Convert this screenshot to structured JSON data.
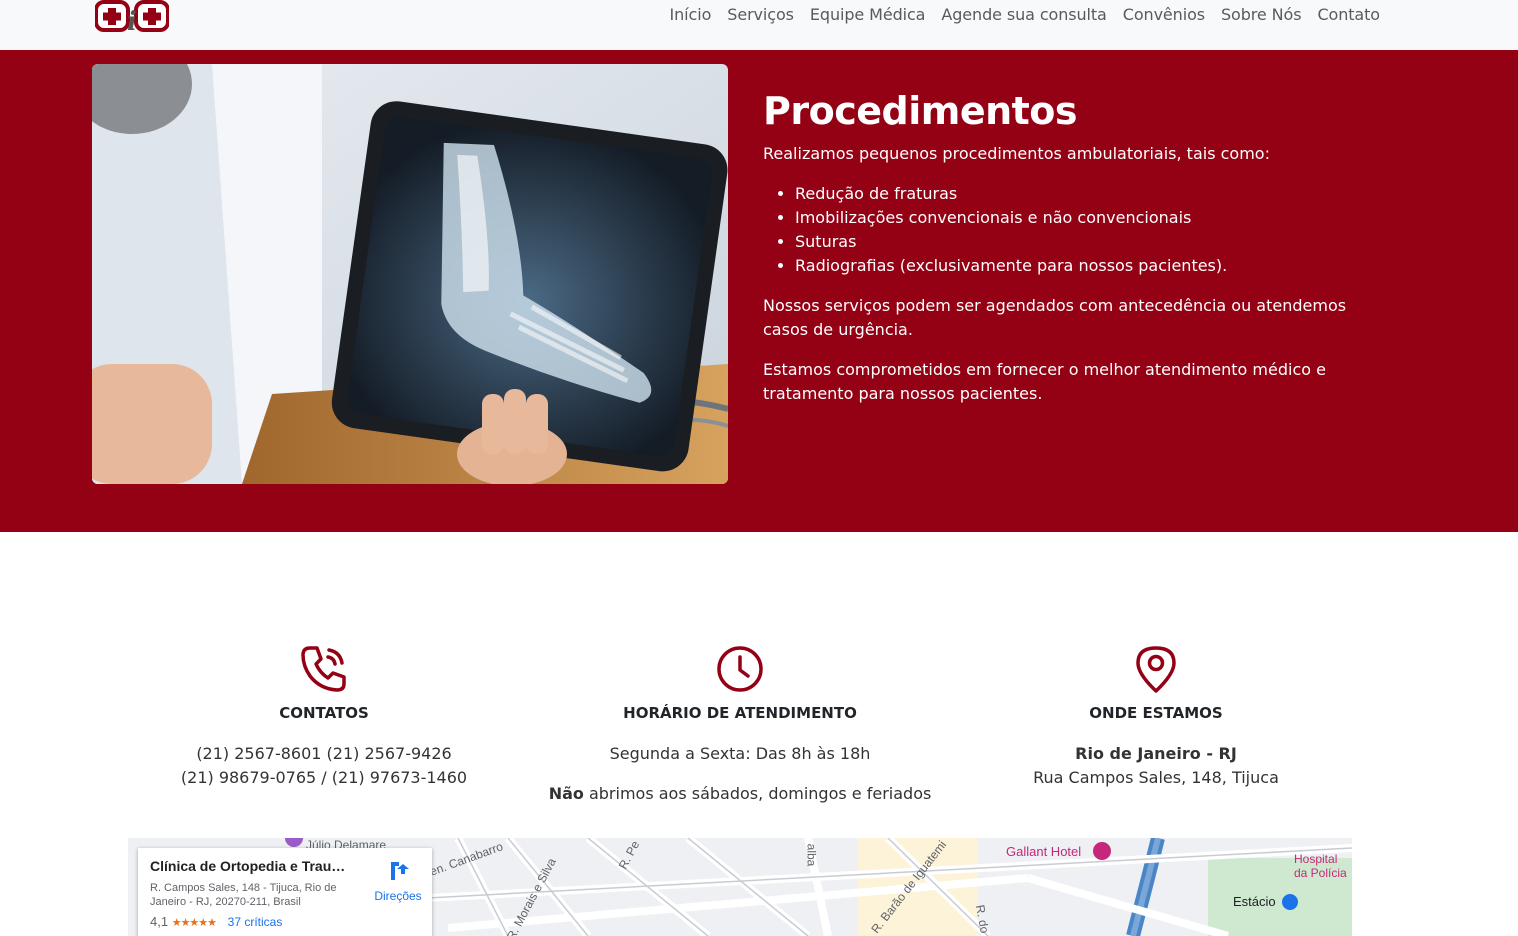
{
  "nav": {
    "logo_alt": "logo",
    "links": [
      "Início",
      "Serviços",
      "Equipe Médica",
      "Agende sua consulta",
      "Convênios",
      "Sobre Nós",
      "Contato"
    ]
  },
  "hero": {
    "title": "Procedimentos",
    "intro": "Realizamos pequenos procedimentos ambulatoriais, tais como:",
    "items": [
      "Redução de fraturas",
      "Imobilizações convencionais e não convencionais",
      "Suturas",
      "Radiografias (exclusivamente para nossos pacientes)."
    ],
    "p1": "Nossos serviços podem ser agendados com antecedência ou atendemos casos de urgência.",
    "p2": "Estamos comprometidos em fornecer o melhor atendimento médico e tratamento para nossos pacientes."
  },
  "info": {
    "contacts": {
      "title": "CONTATOS",
      "line1": "(21) 2567-8601 (21) 2567-9426",
      "line2": "(21) 98679-0765 / (21) 97673-1460"
    },
    "hours": {
      "title": "HORÁRIO DE ATENDIMENTO",
      "line1": "Segunda a Sexta: Das 8h às 18h",
      "bold": "Não",
      "line2_rest": " abrimos aos sábados, domingos e feriados"
    },
    "location": {
      "title": "ONDE ESTAMOS",
      "city": "Rio de Janeiro - RJ",
      "address": "Rua Campos Sales, 148, Tijuca"
    }
  },
  "map": {
    "card_title": "Clínica de Ortopedia e Trauma...",
    "card_address": "R. Campos Sales, 148 - Tijuca, Rio de Janeiro - RJ, 20270-211, Brasil",
    "rating": "4,1",
    "stars": "★★★★★",
    "reviews": "37 críticas",
    "directions": "Direções",
    "labels": {
      "street1": "R. Morais e Silva",
      "street2": "R. Barão de Iguatemi",
      "street3": "R. Pe",
      "street4": "alba",
      "street5": "R. do",
      "street6": "en. Canabarro",
      "poi1": "Júlio Delamare",
      "poi2": "Gallant Hotel",
      "poi3": "Hospital da Polícia",
      "poi4": "Estácio"
    },
    "colors": {
      "poi_pink": "#c5287a",
      "poi_green": "#1e8e3e",
      "water": "#4a86c5"
    }
  },
  "colors": {
    "brand": "#940014",
    "nav_bg": "#f8f9fa"
  }
}
